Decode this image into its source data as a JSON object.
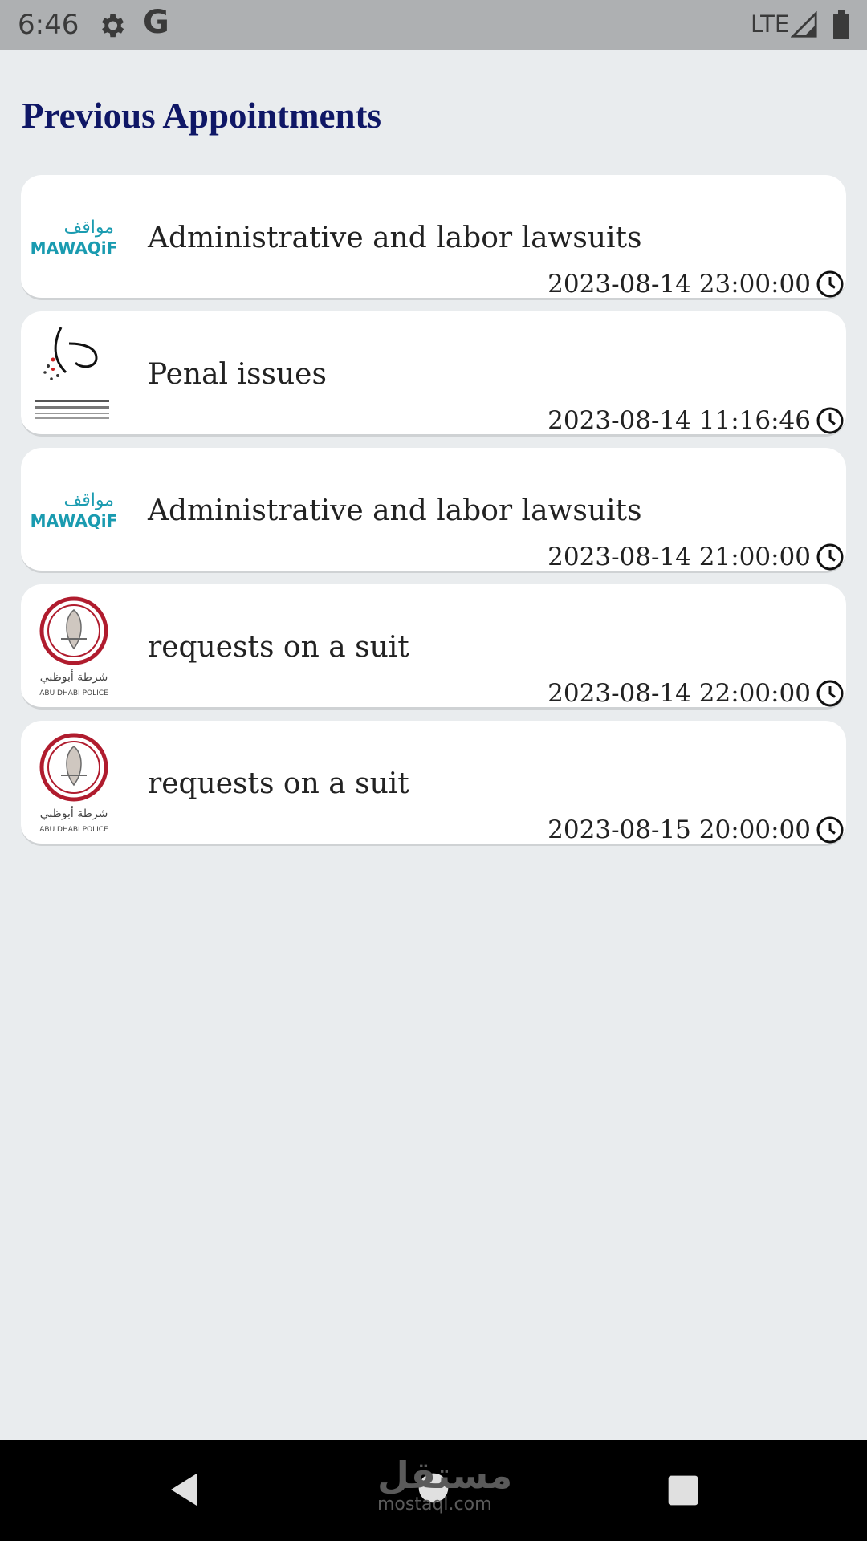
{
  "status_bar": {
    "time": "6:46",
    "google_letter": "G",
    "network": "LTE"
  },
  "page": {
    "title": "Previous Appointments"
  },
  "appointments": [
    {
      "logo": "mawaqif",
      "logo_arabic": "مواقف",
      "logo_text": "MAWAQiF",
      "title": "Administrative and labor lawsuits",
      "datetime": "2023-08-14 23:00:00"
    },
    {
      "logo": "icp-falcon",
      "title": "Penal issues",
      "datetime": "2023-08-14 11:16:46"
    },
    {
      "logo": "mawaqif",
      "logo_arabic": "مواقف",
      "logo_text": "MAWAQiF",
      "title": "Administrative and labor lawsuits",
      "datetime": "2023-08-14 21:00:00"
    },
    {
      "logo": "abu-dhabi-police",
      "logo_arabic": "شرطة أبوظبي",
      "logo_text": "ABU DHABI POLICE",
      "title": "requests on a suit",
      "datetime": "2023-08-14 22:00:00"
    },
    {
      "logo": "abu-dhabi-police",
      "logo_arabic": "شرطة أبوظبي",
      "logo_text": "ABU DHABI POLICE",
      "title": "requests on a suit",
      "datetime": "2023-08-15 20:00:00"
    }
  ],
  "watermark": {
    "arabic": "مستقل",
    "latin": "mostaql.com"
  },
  "colors": {
    "title": "#0f1766",
    "background": "#e9ecee",
    "mawaqif_teal": "#1a9bb0",
    "police_red": "#b01c2e"
  }
}
